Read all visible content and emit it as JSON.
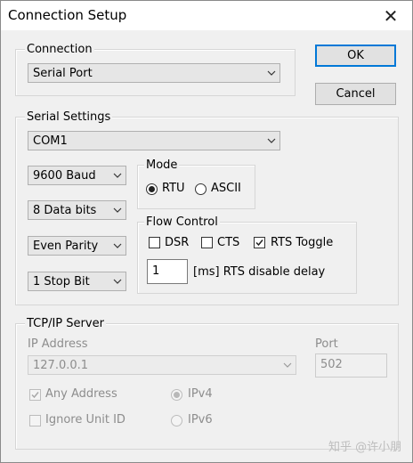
{
  "window": {
    "title": "Connection Setup",
    "close_glyph": "✕"
  },
  "buttons": {
    "ok": "OK",
    "cancel": "Cancel"
  },
  "connection": {
    "group_label": "Connection",
    "selected": "Serial Port"
  },
  "serial": {
    "group_label": "Serial Settings",
    "port": "COM1",
    "baud": "9600 Baud",
    "data_bits": "8 Data bits",
    "parity": "Even Parity",
    "stop_bits": "1 Stop Bit",
    "mode": {
      "label": "Mode",
      "rtu": "RTU",
      "ascii": "ASCII",
      "selected": "RTU"
    },
    "flow": {
      "label": "Flow Control",
      "dsr": "DSR",
      "cts": "CTS",
      "rts_toggle": "RTS Toggle",
      "dsr_checked": false,
      "cts_checked": false,
      "rts_toggle_checked": true,
      "delay_value": "1",
      "delay_label": "[ms] RTS disable delay"
    }
  },
  "tcp": {
    "group_label": "TCP/IP Server",
    "ip_label": "IP Address",
    "ip_value": "127.0.0.1",
    "port_label": "Port",
    "port_value": "502",
    "any_address": "Any Address",
    "any_address_checked": true,
    "ignore_unit_id": "Ignore Unit ID",
    "ignore_unit_id_checked": false,
    "ipv4": "IPv4",
    "ipv6": "IPv6",
    "ip_version_selected": "IPv4"
  },
  "watermark": "知乎 @许小朋"
}
